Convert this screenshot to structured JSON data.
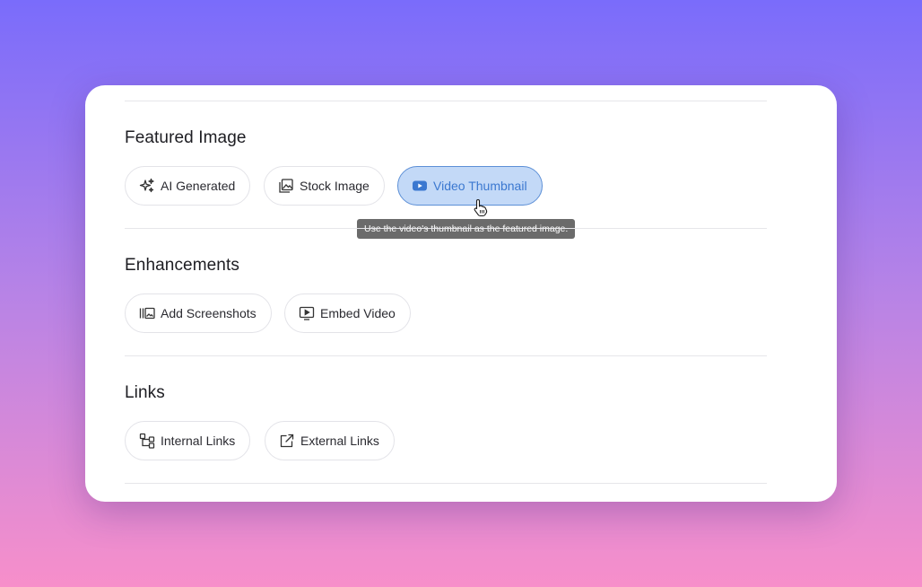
{
  "sections": [
    {
      "title": "Featured Image",
      "buttons": [
        {
          "label": "AI Generated",
          "icon": "sparkles-icon"
        },
        {
          "label": "Stock Image",
          "icon": "image-gallery-icon"
        },
        {
          "label": "Video Thumbnail",
          "icon": "youtube-icon",
          "state": "active"
        }
      ]
    },
    {
      "title": "Enhancements",
      "buttons": [
        {
          "label": "Add Screenshots",
          "icon": "screenshots-icon"
        },
        {
          "label": "Embed Video",
          "icon": "embed-video-icon"
        }
      ]
    },
    {
      "title": "Links",
      "buttons": [
        {
          "label": "Internal Links",
          "icon": "sitemap-icon"
        },
        {
          "label": "External Links",
          "icon": "external-link-icon"
        }
      ]
    }
  ],
  "tooltip": {
    "text": "Use the video's thumbnail as the featured image."
  },
  "colors": {
    "active_bg": "#c3d9f7",
    "active_border": "#5c8fd6",
    "active_text": "#3b78d0",
    "tooltip_bg": "#6b6b6b"
  }
}
